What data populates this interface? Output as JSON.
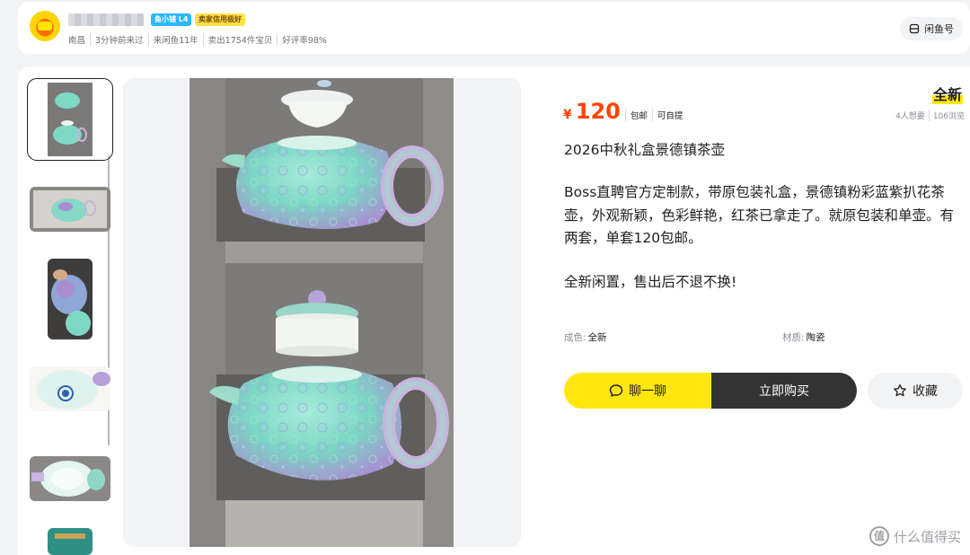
{
  "seller": {
    "level_badge": "鱼小铺 L4",
    "credit_badge": "卖家信用极好",
    "meta": [
      "南昌",
      "3分钟前来过",
      "来闲鱼11年",
      "卖出1754件宝贝",
      "好评率98%"
    ],
    "xianyu_button": "闲鱼号"
  },
  "product": {
    "currency": "¥",
    "price": "120",
    "tags": [
      "包邮",
      "可自提"
    ],
    "condition": "全新",
    "stats": [
      "4人想要",
      "106浏览"
    ],
    "title": "2026中秋礼盒景德镇茶壶",
    "description": "Boss直聘官方定制款，带原包装礼盒，景德镇粉彩蓝紫扒花茶壶，外观新颖，色彩鲜艳，红茶已拿走了。就原包装和单壶。有两套，单套120包邮。",
    "note": "全新闲置，售出后不退不换!",
    "attributes": [
      {
        "key": "成色:",
        "value": "全新"
      },
      {
        "key": "材质:",
        "value": "陶瓷"
      }
    ]
  },
  "actions": {
    "chat": "聊一聊",
    "buy": "立即购买",
    "favorite": "收藏"
  },
  "watermark": "什么值得买",
  "colors": {
    "accent_yellow": "#ffe60f",
    "price_orange": "#ff4400",
    "buy_dark": "#333333"
  }
}
